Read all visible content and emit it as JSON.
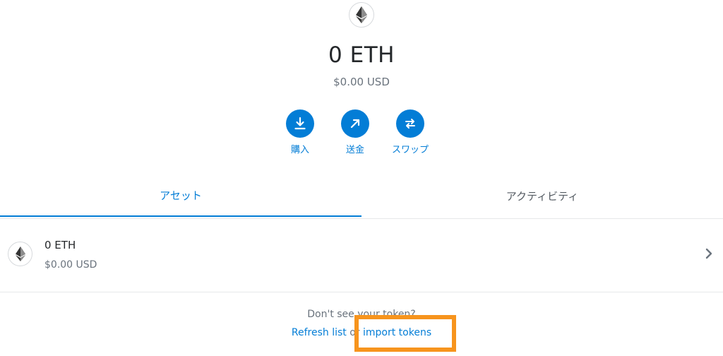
{
  "header": {
    "icon": "ethereum-icon",
    "balance": "0 ETH",
    "fiat": "$0.00 USD"
  },
  "actions": [
    {
      "label": "購入",
      "icon": "download-icon"
    },
    {
      "label": "送金",
      "icon": "arrow-up-right-icon"
    },
    {
      "label": "スワップ",
      "icon": "swap-icon"
    }
  ],
  "tabs": [
    {
      "label": "アセット",
      "active": true
    },
    {
      "label": "アクティビティ",
      "active": false
    }
  ],
  "assets": [
    {
      "name": "0 ETH",
      "value": "$0.00 USD",
      "icon": "ethereum-icon"
    }
  ],
  "footer": {
    "help": "Don't see your token?",
    "refresh": "Refresh list",
    "or": "or",
    "import": "import tokens"
  },
  "colors": {
    "accent": "#037dd6",
    "highlight": "#f7941d",
    "muted": "#6a737d"
  }
}
